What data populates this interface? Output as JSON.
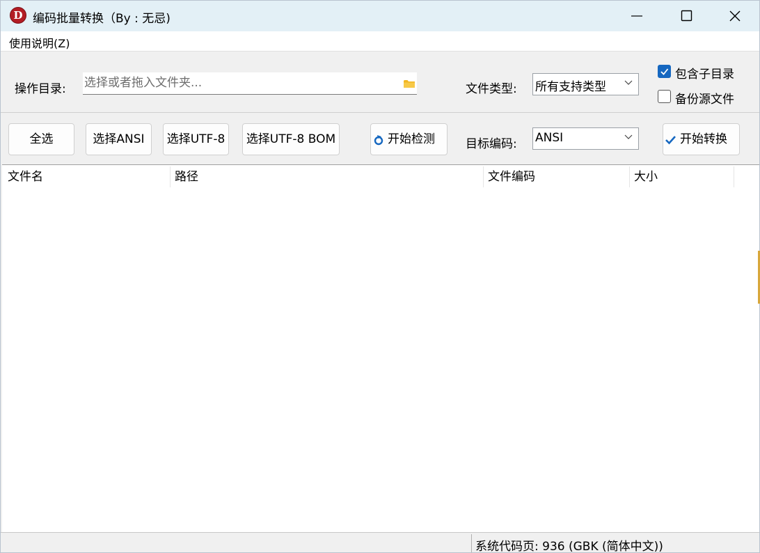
{
  "window": {
    "title": "编码批量转换（By : 无忌)"
  },
  "menu": {
    "help_label": "使用说明(Z)"
  },
  "toolbar": {
    "dir_label": "操作目录:",
    "dir_placeholder": "选择或者拖入文件夹...",
    "dir_value": "",
    "file_type_label": "文件类型:",
    "file_type_value": "所有支持类型",
    "include_subdirs_label": "包含子目录",
    "include_subdirs_checked": true,
    "backup_label": "备份源文件",
    "backup_checked": false,
    "select_all_label": "全选",
    "select_ansi_label": "选择ANSI",
    "select_utf8_label": "选择UTF-8",
    "select_utf8_bom_label": "选择UTF-8 BOM",
    "detect_label": "开始检测",
    "target_encoding_label": "目标编码:",
    "target_encoding_value": "ANSI",
    "convert_label": "开始转换"
  },
  "table": {
    "columns": [
      "文件名",
      "路径",
      "文件编码",
      "大小"
    ],
    "rows": []
  },
  "status": {
    "codepage_text": "系统代码页: 936 (GBK (简体中文))"
  },
  "colors": {
    "titlebar_bg": "#e3f0f6",
    "accent": "#1567c0",
    "app_icon_red": "#b31d24",
    "folder_yellow": "#f2b722"
  },
  "icons": {
    "app": "app-logo-d-icon",
    "folder": "folder-icon",
    "detect": "refresh-icon",
    "convert": "checkmark-icon"
  }
}
